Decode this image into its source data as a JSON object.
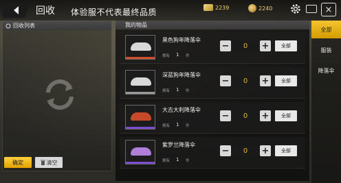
{
  "header": {
    "title": "回收",
    "notice": "体验服不代表最终品质",
    "currency_a": "2239",
    "currency_b": "2240",
    "close_symbol": "×"
  },
  "recycle_panel": {
    "title": "回收列表",
    "confirm_label": "确定",
    "clear_label": "清空"
  },
  "items_panel": {
    "title": "我的物品",
    "own_label": "拥有",
    "unit": "件",
    "all_label": "全部",
    "items": [
      {
        "name": "黑色狗年降落伞",
        "owned": "1",
        "qty": "0",
        "accent": "#d24b2a",
        "chute": "#d8d8d8"
      },
      {
        "name": "深蓝狗年降落伞",
        "owned": "1",
        "qty": "0",
        "accent": "#9a9a9a",
        "chute": "#d8d8d8"
      },
      {
        "name": "大吉大利降落伞",
        "owned": "1",
        "qty": "0",
        "accent": "#7c4bd1",
        "chute": "#c64a2a"
      },
      {
        "name": "紫罗兰降落伞",
        "owned": "1",
        "qty": "0",
        "accent": "#7c4bd1",
        "chute": "#b07fd8"
      }
    ]
  },
  "side_tabs": [
    {
      "label": "全部",
      "active": true
    },
    {
      "label": "服装",
      "active": false
    },
    {
      "label": "降落伞",
      "active": false
    }
  ]
}
